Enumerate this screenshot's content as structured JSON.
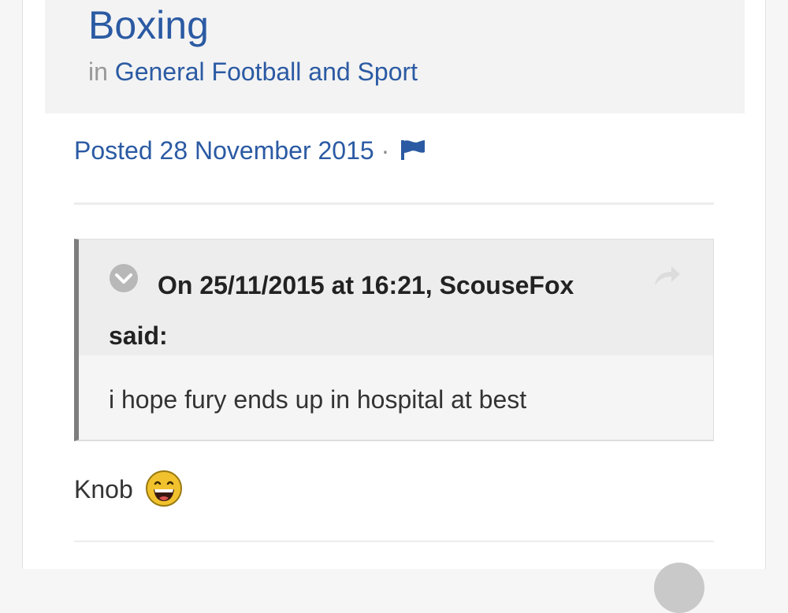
{
  "topic": {
    "title": "Boxing",
    "in_label": "in",
    "forum": "General Football and Sport"
  },
  "post": {
    "posted_text": "Posted 28 November 2015",
    "separator": "·",
    "quote": {
      "citation": "On 25/11/2015 at 16:21, ScouseFox said:",
      "body": "i hope fury ends up in hospital at best"
    },
    "content": "Knob"
  },
  "icons": {
    "flag": "flag-icon",
    "toggle": "chevron-down-icon",
    "share": "share-arrow-icon",
    "emoji": "laughing-emoji-icon"
  },
  "colors": {
    "link": "#2b5aa3",
    "header_bg": "#f3f3f3",
    "quote_border": "#7d7d7d"
  }
}
